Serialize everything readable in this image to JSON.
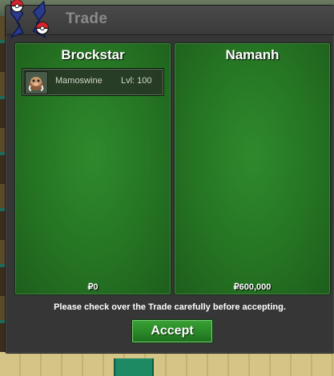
{
  "window": {
    "title": "Trade",
    "icon": "trade-logo-icon"
  },
  "left_panel": {
    "player_name": "Brockstar",
    "money": "₽0",
    "items": [
      {
        "icon": "mamoswine-sprite-icon",
        "name": "Mamoswine",
        "level": "Lvl: 100"
      }
    ]
  },
  "right_panel": {
    "player_name": "Namanh",
    "money": "₽600,000",
    "items": []
  },
  "footer": {
    "notice": "Please check over the Trade carefully before accepting.",
    "accept_label": "Accept"
  },
  "colors": {
    "panel_green": "#257423",
    "accept_green": "#2a8a28",
    "window_bg": "#363636"
  }
}
